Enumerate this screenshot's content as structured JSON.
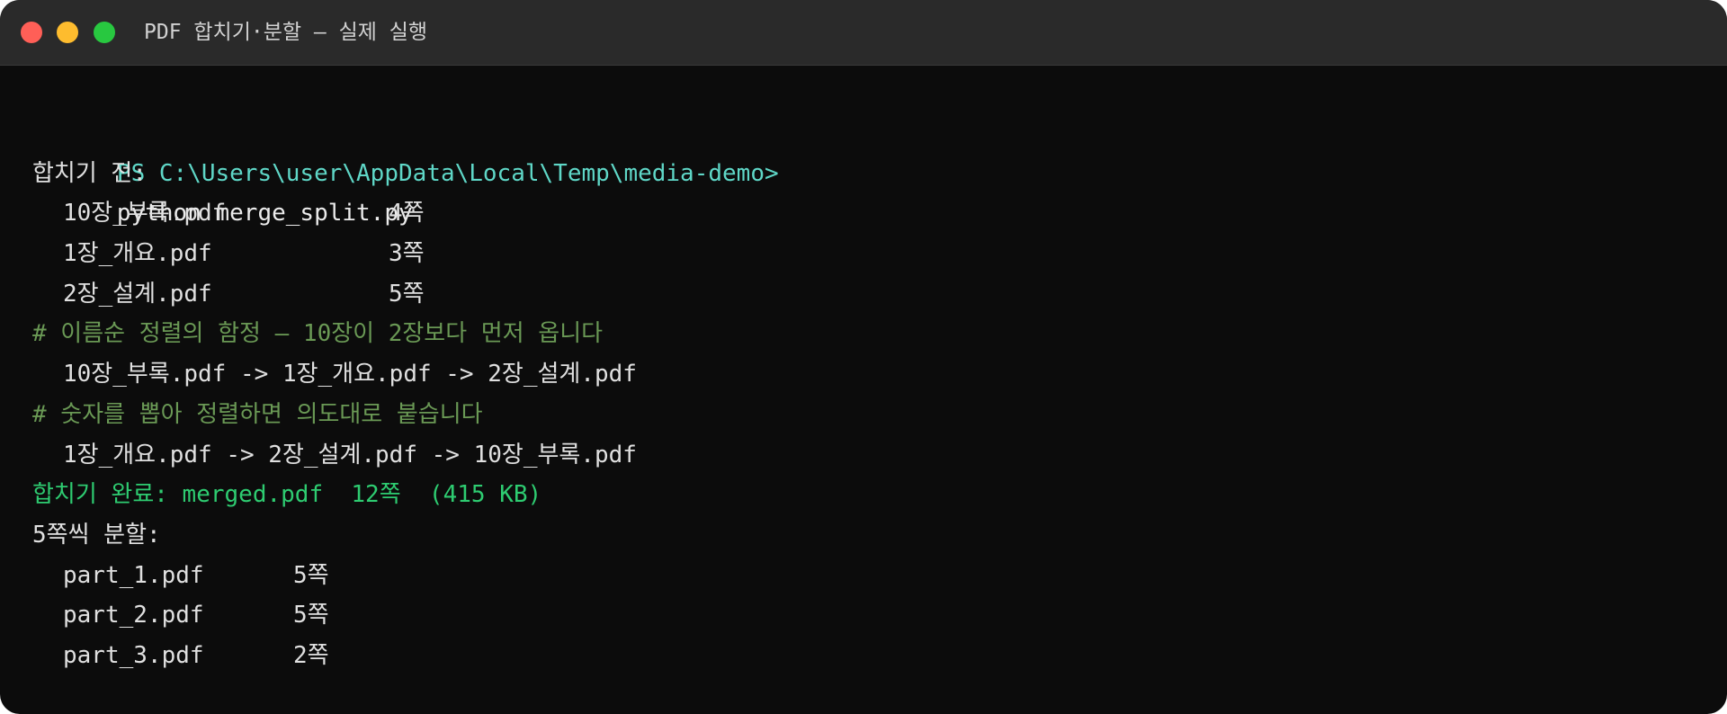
{
  "window": {
    "title": "PDF 합치기·분할 — 실제 실행",
    "controls": {
      "close_color": "#ff5f57",
      "minimize_color": "#febc2e",
      "maximize_color": "#28c840"
    }
  },
  "terminal": {
    "prompt": "PS C:\\Users\\user\\AppData\\Local\\Temp\\media-demo>",
    "command": "python merge_split.py",
    "before_header": "합치기 전:",
    "before_files": [
      {
        "name": "10장_부록.pdf",
        "pages": "4쪽"
      },
      {
        "name": "1장_개요.pdf",
        "pages": "3쪽"
      },
      {
        "name": "2장_설계.pdf",
        "pages": "5쪽"
      }
    ],
    "comment_name_sort": "# 이름순 정렬의 함정 — 10장이 2장보다 먼저 옵니다",
    "name_sort_order": "10장_부록.pdf -> 1장_개요.pdf -> 2장_설계.pdf",
    "comment_number_sort": "# 숫자를 뽑아 정렬하면 의도대로 붙습니다",
    "number_sort_order": "1장_개요.pdf -> 2장_설계.pdf -> 10장_부록.pdf",
    "merge_done": "합치기 완료: merged.pdf  12쪽  (415 KB)",
    "split_header": "5쪽씩 분할:",
    "split_files": [
      {
        "name": "part_1.pdf",
        "pages": "5쪽"
      },
      {
        "name": "part_2.pdf",
        "pages": "5쪽"
      },
      {
        "name": "part_3.pdf",
        "pages": "2쪽"
      }
    ]
  },
  "colors": {
    "background": "#0c0c0c",
    "titlebar": "#2a2a2a",
    "prompt": "#5fd7c7",
    "comment": "#6a9955",
    "success": "#2ecc71",
    "text": "#e0e0e0"
  }
}
